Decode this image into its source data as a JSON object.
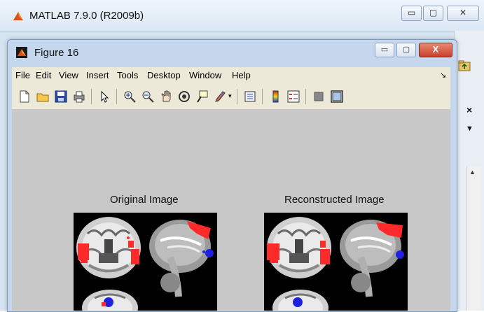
{
  "matlab": {
    "title": "MATLAB  7.9.0 (R2009b)",
    "min_label": "▭",
    "max_label": "▢",
    "close_label": "✕"
  },
  "figure": {
    "title": "Figure 16",
    "close_label": "X",
    "menu": [
      "File",
      "Edit",
      "View",
      "Insert",
      "Tools",
      "Desktop",
      "Window",
      "Help"
    ],
    "toolbar_icons": [
      "new-figure-icon",
      "open-file-icon",
      "save-icon",
      "print-icon",
      "pointer-icon",
      "zoom-in-icon",
      "zoom-out-icon",
      "pan-icon",
      "rotate-3d-icon",
      "data-cursor-icon",
      "brush-icon",
      "link-plot-icon",
      "colorbar-icon",
      "legend-icon",
      "hide-plot-tools-icon",
      "show-plot-tools-icon"
    ],
    "axes": [
      {
        "title": "Original Image"
      },
      {
        "title": "Reconstructed Image"
      }
    ]
  },
  "panel": {
    "close_label": "×",
    "dropdown_label": "▼",
    "scroll_up_label": "▲"
  },
  "colors": {
    "activation": "#ff2a2a",
    "blue_spot": "#2020e0",
    "canvas": "#c8c8c8"
  }
}
